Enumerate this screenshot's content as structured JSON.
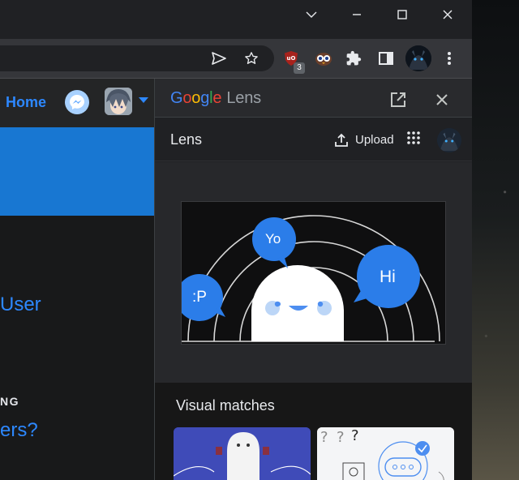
{
  "page": {
    "home_label": "Home",
    "user_link": "User",
    "section_label": "NG",
    "question_link": "ers?"
  },
  "toolbar": {
    "extension_badge": "3"
  },
  "lens": {
    "logo_letters": [
      "G",
      "o",
      "o",
      "g",
      "l",
      "e"
    ],
    "logo_colors": [
      "#4285f4",
      "#ea4335",
      "#fbbc05",
      "#4285f4",
      "#34a853",
      "#ea4335"
    ],
    "logo_suffix": "Lens",
    "title": "Lens",
    "upload_label": "Upload",
    "image_bubbles": {
      "yo": "Yo",
      "hi": "Hi",
      "tongue": ":P"
    },
    "visual_matches_title": "Visual matches"
  },
  "icons": {
    "window": [
      "chevron-down-icon",
      "minimize-icon",
      "maximize-icon",
      "close-icon"
    ],
    "toolbar": [
      "send-icon",
      "star-icon",
      "ublock-icon",
      "owl-extension-icon",
      "puzzle-icon",
      "side-panel-icon",
      "profile-avatar",
      "more-vert-icon"
    ],
    "lens": [
      "open-in-new-icon",
      "close-icon",
      "upload-icon",
      "apps-grid-icon"
    ]
  },
  "colors": {
    "accent_blue": "#2d88ff",
    "banner_blue": "#1877d2",
    "bubble_blue": "#1a73e8"
  }
}
